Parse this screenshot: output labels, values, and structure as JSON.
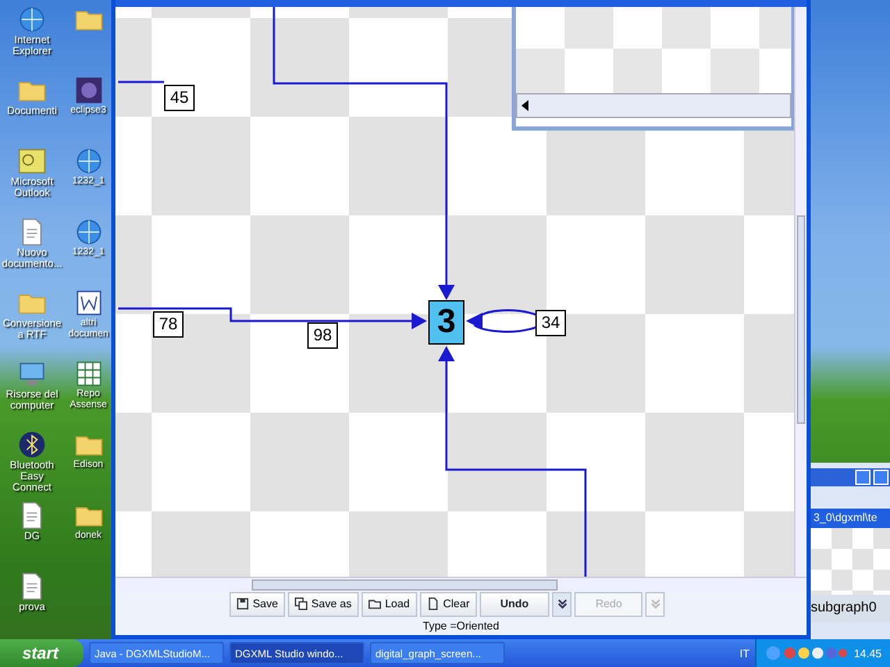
{
  "desktop_icons": [
    {
      "kind": "globe",
      "label": "Internet Explorer"
    },
    {
      "kind": "folder",
      "label": "Documenti"
    },
    {
      "kind": "mail",
      "label": "Microsoft Outlook"
    },
    {
      "kind": "document",
      "label": "Nuovo documento..."
    },
    {
      "kind": "folder",
      "label": "Conversione a RTF"
    },
    {
      "kind": "computer",
      "label": "Risorse del computer"
    },
    {
      "kind": "bluetooth",
      "label": "Bluetooth Easy Connect"
    },
    {
      "kind": "document",
      "label": "DG"
    },
    {
      "kind": "document",
      "label": "prova"
    }
  ],
  "desktop_icons_2": [
    {
      "kind": "folder"
    },
    {
      "kind": "app",
      "label": "eclipse3"
    },
    {
      "kind": "globe",
      "label": "1232_1"
    },
    {
      "kind": "globe",
      "label": "1232_1"
    },
    {
      "kind": "word",
      "label": "altri documen"
    },
    {
      "kind": "spreadsheet",
      "label": "Repo Assense"
    },
    {
      "kind": "folder",
      "label": "Edison"
    },
    {
      "kind": "folder",
      "label": "donek"
    }
  ],
  "graph": {
    "nodes": [
      {
        "label": "3",
        "selected": true
      }
    ],
    "edge_labels": [
      "45",
      "78",
      "98",
      "34"
    ]
  },
  "toolbar": [
    {
      "kind": "save",
      "label": "Save",
      "disabled": false
    },
    {
      "kind": "saveas",
      "label": "Save as",
      "disabled": false
    },
    {
      "kind": "load",
      "label": "Load",
      "disabled": false
    },
    {
      "kind": "clear",
      "label": "Clear",
      "disabled": false
    },
    {
      "kind": "button",
      "label": "Undo",
      "disabled": false
    },
    {
      "kind": "dropdown",
      "disabled": false
    },
    {
      "kind": "button",
      "label": "Redo",
      "disabled": true
    },
    {
      "kind": "dropdown",
      "disabled": true
    }
  ],
  "status": "Type =Oriented",
  "back_window": {
    "path": "3_0\\dgxml\\te",
    "item": "subgraph0"
  },
  "taskbar": {
    "start": "start",
    "tasks": [
      {
        "label": "Java - DGXMLStudioM...",
        "selected": false
      },
      {
        "label": "DGXML Studio windo...",
        "selected": true
      },
      {
        "label": "digital_graph_screen...",
        "selected": false
      }
    ],
    "language": "IT",
    "clock": "14.45"
  }
}
